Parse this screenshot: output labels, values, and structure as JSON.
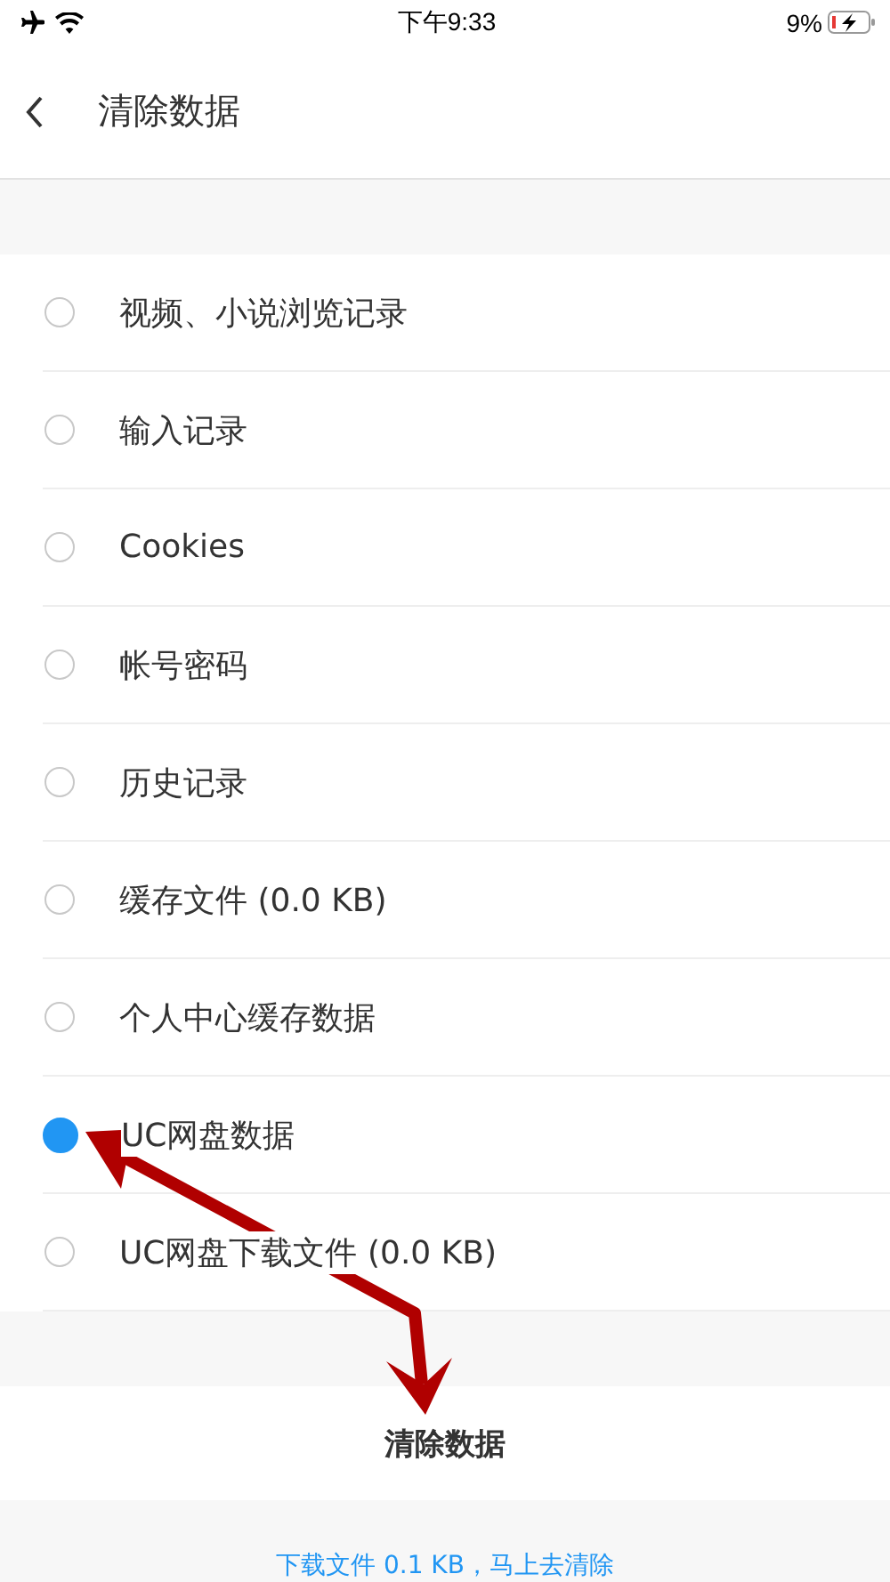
{
  "status_bar": {
    "time": "下午9:33",
    "battery": "9%"
  },
  "header": {
    "title": "清除数据"
  },
  "options": [
    {
      "label": "视频、小说浏览记录",
      "selected": false
    },
    {
      "label": "输入记录",
      "selected": false
    },
    {
      "label": "Cookies",
      "selected": false
    },
    {
      "label": "帐号密码",
      "selected": false
    },
    {
      "label": "历史记录",
      "selected": false
    },
    {
      "label": "缓存文件 (0.0 KB)",
      "selected": false
    },
    {
      "label": "个人中心缓存数据",
      "selected": false
    },
    {
      "label": "UC网盘数据",
      "selected": true
    },
    {
      "label": "UC网盘下载文件 (0.0 KB)",
      "selected": false
    }
  ],
  "clear_button": "清除数据",
  "download_link": "下载文件 0.1 KB，马上去清除"
}
